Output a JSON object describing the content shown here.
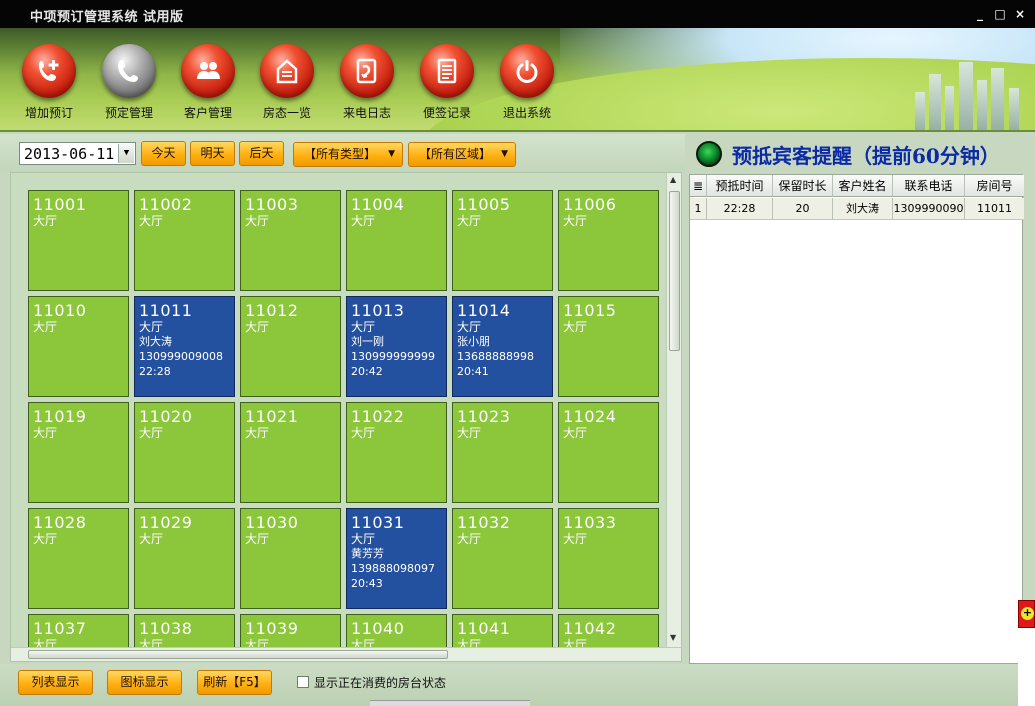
{
  "window": {
    "title": "中项预订管理系统  试用版",
    "controls": [
      "_",
      "□",
      "×"
    ]
  },
  "toolbar": {
    "items": [
      {
        "label": "增加预订",
        "icon": "phone-plus-icon"
      },
      {
        "label": "预定管理",
        "icon": "phone-icon"
      },
      {
        "label": "客户管理",
        "icon": "users-icon"
      },
      {
        "label": "房态一览",
        "icon": "room-status-icon"
      },
      {
        "label": "来电日志",
        "icon": "call-log-icon"
      },
      {
        "label": "便签记录",
        "icon": "notes-icon"
      },
      {
        "label": "退出系统",
        "icon": "power-icon"
      }
    ]
  },
  "filters": {
    "date": "2013-06-11",
    "today": "今天",
    "tomorrow": "明天",
    "after_tomorrow": "后天",
    "type_select": "【所有类型】",
    "area_select": "【所有区域】"
  },
  "rooms": [
    {
      "num": "11001",
      "type": "大厅"
    },
    {
      "num": "11002",
      "type": "大厅"
    },
    {
      "num": "11003",
      "type": "大厅"
    },
    {
      "num": "11004",
      "type": "大厅"
    },
    {
      "num": "11005",
      "type": "大厅"
    },
    {
      "num": "11006",
      "type": "大厅"
    },
    {
      "num": "11010",
      "type": "大厅"
    },
    {
      "num": "11011",
      "type": "大厅",
      "name": "刘大涛",
      "phone": "130999009008",
      "time": "22:28"
    },
    {
      "num": "11012",
      "type": "大厅"
    },
    {
      "num": "11013",
      "type": "大厅",
      "name": "刘一刚",
      "phone": "130999999999",
      "time": "20:42"
    },
    {
      "num": "11014",
      "type": "大厅",
      "name": "张小朋",
      "phone": "13688888998",
      "time": "20:41"
    },
    {
      "num": "11015",
      "type": "大厅"
    },
    {
      "num": "11019",
      "type": "大厅"
    },
    {
      "num": "11020",
      "type": "大厅"
    },
    {
      "num": "11021",
      "type": "大厅"
    },
    {
      "num": "11022",
      "type": "大厅"
    },
    {
      "num": "11023",
      "type": "大厅"
    },
    {
      "num": "11024",
      "type": "大厅"
    },
    {
      "num": "11028",
      "type": "大厅"
    },
    {
      "num": "11029",
      "type": "大厅"
    },
    {
      "num": "11030",
      "type": "大厅"
    },
    {
      "num": "11031",
      "type": "大厅",
      "name": "黄芳芳",
      "phone": "139888098097",
      "time": "20:43"
    },
    {
      "num": "11032",
      "type": "大厅"
    },
    {
      "num": "11033",
      "type": "大厅"
    },
    {
      "num": "11037",
      "type": "大厅"
    },
    {
      "num": "11038",
      "type": "大厅"
    },
    {
      "num": "11039",
      "type": "大厅"
    },
    {
      "num": "11040",
      "type": "大厅"
    },
    {
      "num": "11041",
      "type": "大厅"
    },
    {
      "num": "11042",
      "type": "大厅"
    }
  ],
  "colors": {
    "room_free": "#8cc63a",
    "room_booked": "#2450a0",
    "title_blue": "#0b2aa6"
  },
  "reminder": {
    "title": "预抵宾客提醒（提前60分钟）",
    "columns": [
      "预抵时间",
      "保留时长",
      "客户姓名",
      "联系电话",
      "房间号"
    ],
    "rows": [
      {
        "idx": "1",
        "arrive": "22:28",
        "keep": "20",
        "name": "刘大涛",
        "phone": "1309990090",
        "room": "11011"
      }
    ]
  },
  "bottom": {
    "list_view": "列表显示",
    "icon_view": "图标显示",
    "refresh": "刷新【F5】",
    "show_consuming_label": "显示正在消费的房台状态",
    "show_consuming_checked": false
  }
}
